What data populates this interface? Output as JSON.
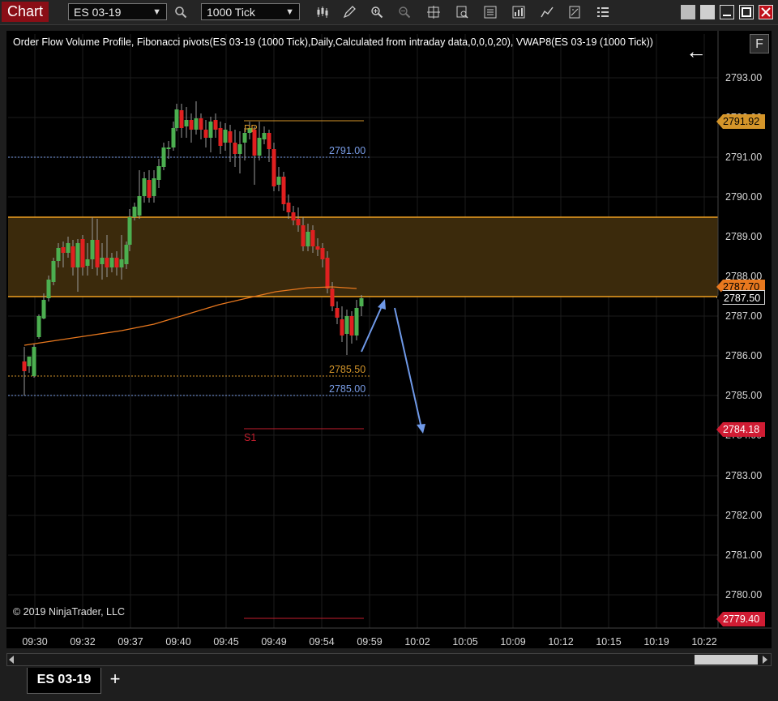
{
  "toolbar": {
    "app_label": "Chart",
    "instrument": "ES 03-19",
    "interval": "1000 Tick"
  },
  "chart": {
    "indicator_label": "Order Flow Volume Profile, Fibonacci pivots(ES 03-19 (1000 Tick),Daily,Calculated from intraday data,0,0,0,20), VWAP8(ES 03-19 (1000 Tick))",
    "copyright": "© 2019 NinjaTrader, LLC",
    "f_button": "F",
    "back_arrow": "←",
    "y_ticks": [
      "2793.00",
      "2792.00",
      "2791.00",
      "2790.00",
      "2789.00",
      "2788.00",
      "2787.00",
      "2786.00",
      "2785.00",
      "2784.00",
      "2783.00",
      "2782.00",
      "2781.00",
      "2780.00"
    ],
    "x_ticks": [
      "09:30",
      "09:32",
      "09:37",
      "09:40",
      "09:45",
      "09:49",
      "09:54",
      "09:59",
      "10:02",
      "10:05",
      "10:09",
      "10:12",
      "10:15",
      "10:19",
      "10:22"
    ],
    "levels": {
      "pp": "PP",
      "s1": "S1",
      "l2791": "2791.00",
      "l2785_5": "2785.50",
      "l2785": "2785.00"
    },
    "price_tags": {
      "pp_tag": "2791.92",
      "vwap_tag": "2787.70",
      "current_tag": "2787.50",
      "s1_tag": "2784.18",
      "s2_tag": "2779.40"
    },
    "colors": {
      "up_candle": "#4caf50",
      "down_candle": "#e02020",
      "zone_fill": "#3b2a0c",
      "zone_border": "#f0a020",
      "vwap": "#e8781e",
      "pivot": "#d4952a",
      "support": "#c41e2e",
      "dashed_blue": "#7a9ee8",
      "annotation_arrow": "#6f99e8"
    }
  },
  "tabs": {
    "active_tab": "ES 03-19",
    "add_tab": "+"
  }
}
